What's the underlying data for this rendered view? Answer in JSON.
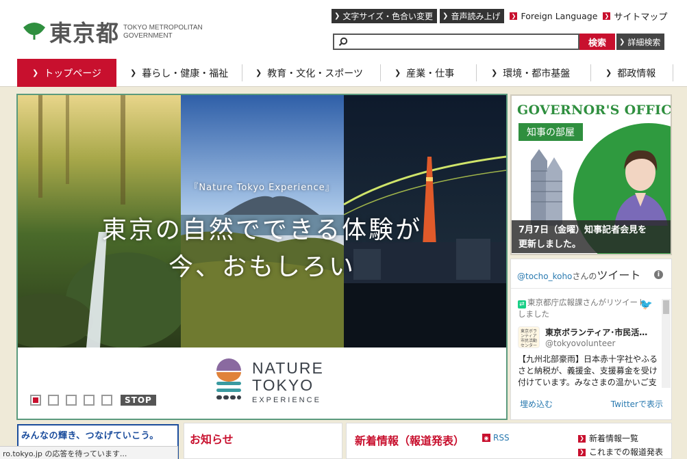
{
  "logo": {
    "kanji": "東京都",
    "english_line1": "TOKYO METROPOLITAN",
    "english_line2": "GOVERNMENT"
  },
  "utility": {
    "text_color_label": "文字サイズ・色合い変更",
    "speech_label": "音声読み上げ",
    "foreign_language_label": "Foreign Language",
    "sitemap_label": "サイトマップ"
  },
  "search": {
    "value": "",
    "button_label": "検索",
    "advanced_label": "詳細検索"
  },
  "nav": {
    "items": [
      {
        "label": "トップページ",
        "active": true
      },
      {
        "label": "暮らし・健康・福祉"
      },
      {
        "label": "教育・文化・スポーツ"
      },
      {
        "label": "産業・仕事"
      },
      {
        "label": "環境・都市基盤"
      },
      {
        "label": "都政情報"
      }
    ]
  },
  "hero": {
    "subtitle": "『Nature Tokyo Experience』",
    "headline_line1": "東京の自然でできる体験が",
    "headline_line2": "今、おもしろい",
    "logo_line1": "NATURE",
    "logo_line2": "TOKYO",
    "logo_line3": "EXPERIENCE",
    "slides_total": 5,
    "current_slide": 1,
    "stop_label": "STOP"
  },
  "governor": {
    "title": "GOVERNOR'S OFFICE",
    "tag": "知事の部屋",
    "news_line1": "7月7日（金曜）知事記者会見を",
    "news_line2": "更新しました。"
  },
  "twitter": {
    "handle": "@tocho_koho",
    "handle_suffix": "さんの",
    "header_word": "ツイート",
    "retweet_text": "東京都庁広報課さんがリツイートしました",
    "user_name": "東京ボランティア･市民活…",
    "user_handle": "@tokyovolunteer",
    "avatar_text": "東京ボランティア 市民活動センター",
    "tweet_body": "【九州北部豪雨】日本赤十字社やふるさと納税が、義援金、支援募金を受け付けています。みなさまの温かいご支援",
    "embed_label": "埋め込む",
    "view_label": "Twitterで表示"
  },
  "bottom": {
    "banner_text": "みんなの輝き、つなげていこう。",
    "notice_title": "お知らせ",
    "press_title": "新着情報（報道発表）",
    "rss_label": "RSS",
    "link_latest": "新着情報一覧",
    "link_past": "これまでの報道発表"
  },
  "statusbar": {
    "text": "ro.tokyo.jp の応答を待っています..."
  },
  "colors": {
    "brand_red": "#c8102e",
    "brand_green": "#2f8f3f",
    "nav_bg": "#ffffff",
    "page_bg": "#efead8"
  }
}
